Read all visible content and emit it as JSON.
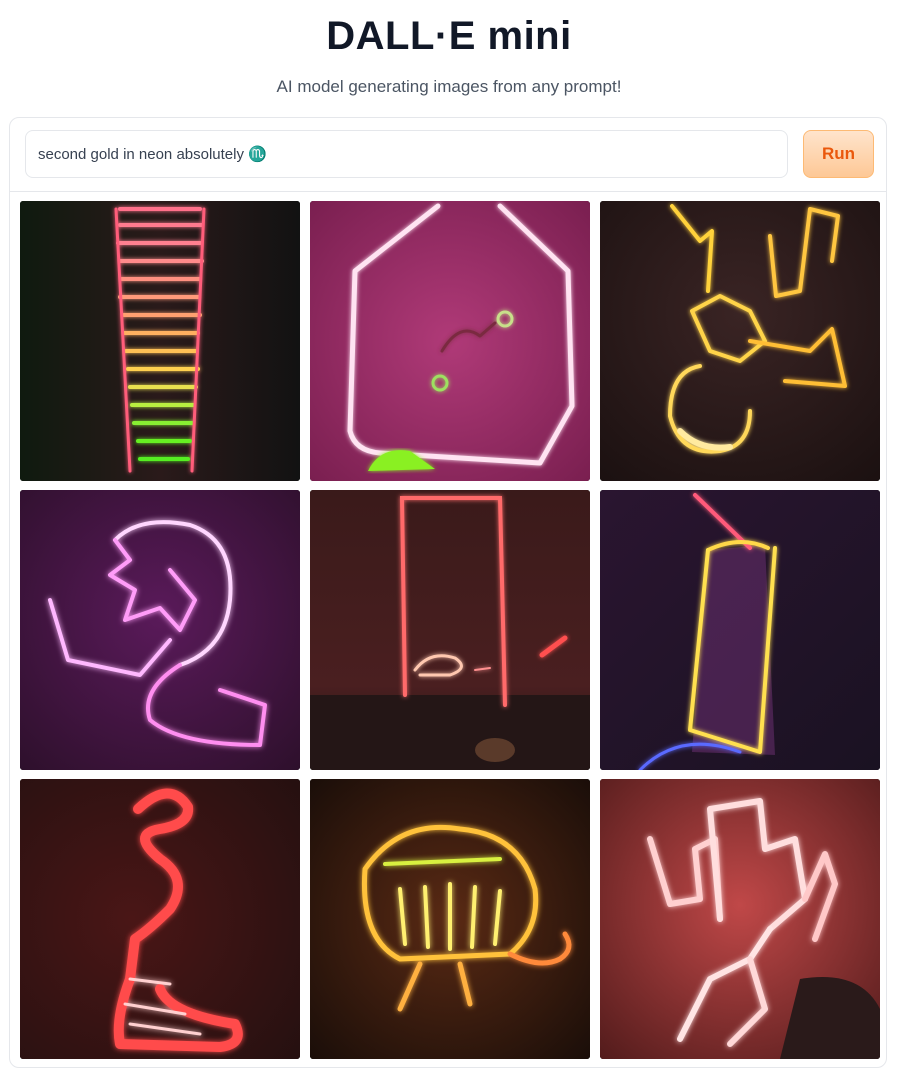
{
  "header": {
    "title": "DALL·E mini",
    "subtitle": "AI model generating images from any prompt!"
  },
  "prompt": {
    "value": "second gold in neon absolutely ♏",
    "run_label": "Run"
  },
  "colors": {
    "accent": "#ea580c",
    "button_bg": "#fdc896"
  },
  "gallery": {
    "image_count": 9
  }
}
